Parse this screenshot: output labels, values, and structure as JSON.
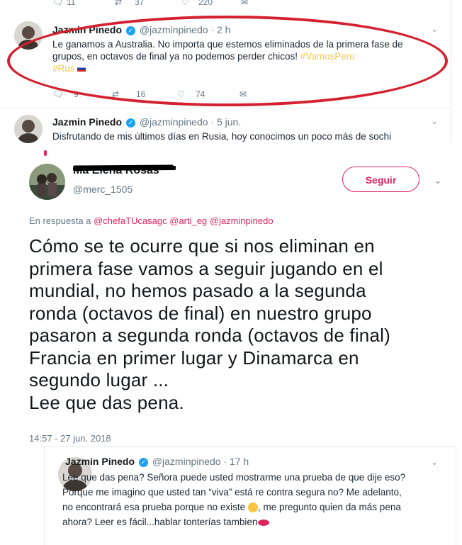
{
  "top_tweet_stats": {
    "replies": "11",
    "retweets": "37",
    "likes": "220"
  },
  "tweet1": {
    "name": "Jazmin Pinedo",
    "handle": "@jazminpinedo",
    "time": "· 2 h",
    "text_line1": "Le ganamos a Australia. No importa que estemos eliminados de la primera fase de",
    "text_line2": "grupos, en octavos de final ya no podemos perder chicos!",
    "hashtag1": "#VamosPeru",
    "hashtag2": "#Rus",
    "replies": "9",
    "retweets": "16",
    "likes": "74"
  },
  "tweet2": {
    "name": "Jazmin Pinedo",
    "handle": "@jazminpinedo",
    "time": "· 5 jun.",
    "text": "Disfrutando de mis últimos días en Rusia, hoy conocimos un poco más de sochi"
  },
  "main_tweet": {
    "name": "Ma Elena Rosas",
    "handle": "@merc_1505",
    "follow_label": "Seguir",
    "reply_prefix": "En respuesta a",
    "reply_mentions": "@chefaTUcasagc @arti_eg @jazminpinedo",
    "lines": [
      "Cómo se te ocurre que si nos eliminan en",
      "primera fase vamos a seguir jugando en el",
      "mundial, no hemos pasado a la segunda",
      "ronda (octavos de final) en nuestro grupo",
      "pasaron a segunda ronda (octavos de final)",
      "Francia en primer lugar y Dinamarca en",
      "segundo lugar ...",
      "Lee que das pena."
    ],
    "timestamp": "14:57 - 27 jun. 2018"
  },
  "reply_tweet": {
    "name": "Jazmin Pinedo",
    "handle": "@jazminpinedo",
    "time": "· 17 h",
    "lines": [
      "Lee que das pena? Señora puede usted mostrarme una prueba de que dije eso?",
      "Porque me imagino que usted tan “viva” está re contra segura no? Me adelanto,",
      "no encontrará esa prueba porque no existe",
      ", me pregunto quien da más pena",
      "ahora? Leer es fácil...hablar tonterías tambien"
    ]
  },
  "colors": {
    "brand_pink": "#e0245e",
    "twitter_blue": "#1da1f2",
    "annotation_red": "#d4202f"
  },
  "icons": [
    "reply-icon",
    "retweet-icon",
    "like-icon",
    "message-icon",
    "verified-icon",
    "chevron-down-icon"
  ]
}
